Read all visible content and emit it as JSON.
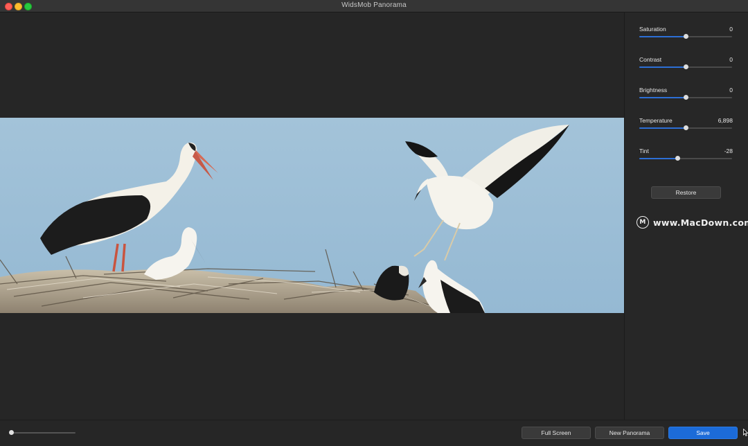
{
  "window": {
    "title": "WidsMob Panorama"
  },
  "adjustments": [
    {
      "label": "Saturation",
      "value": "0",
      "fraction": 0.5
    },
    {
      "label": "Contrast",
      "value": "0",
      "fraction": 0.5
    },
    {
      "label": "Brightness",
      "value": "0",
      "fraction": 0.5
    },
    {
      "label": "Temperature",
      "value": "6,898",
      "fraction": 0.5
    },
    {
      "label": "Tint",
      "value": "-28",
      "fraction": 0.41
    }
  ],
  "panel": {
    "restore_label": "Restore"
  },
  "watermark": {
    "text": "www.MacDown.com"
  },
  "zoom": {
    "fraction": 0.0
  },
  "toolbar": {
    "fullscreen_label": "Full Screen",
    "new_panorama_label": "New Panorama",
    "save_label": "Save"
  },
  "colors": {
    "accent": "#2d6fd6",
    "save_button": "#1c6bd8",
    "sky": "#9cbfd8"
  }
}
